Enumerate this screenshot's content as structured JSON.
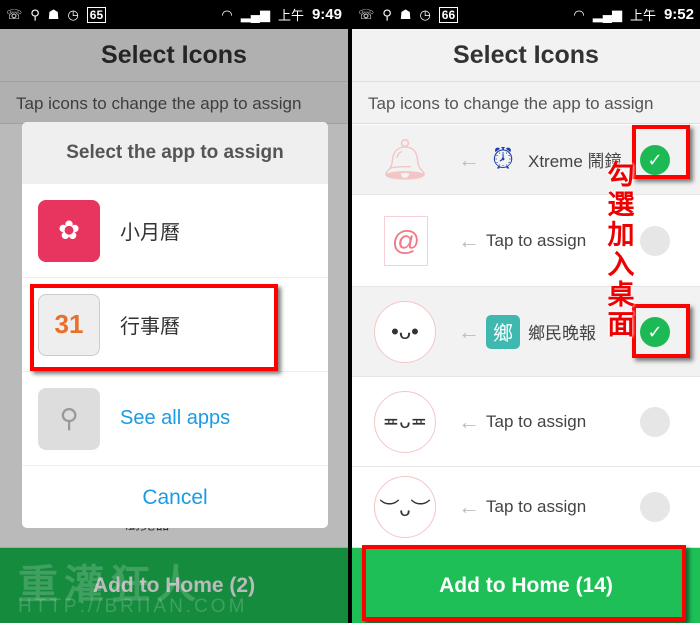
{
  "left": {
    "status": {
      "battery": "65",
      "time_prefix": "上午",
      "time": "9:49"
    },
    "header": {
      "title": "Select Icons"
    },
    "subtitle": "Tap icons to change the app to assign",
    "background_item": "瀏覽器",
    "dialog": {
      "title": "Select the app to assign",
      "items": [
        {
          "label": "小月曆",
          "icon": "pink-calendar-book-icon"
        },
        {
          "label": "行事曆",
          "icon": "calendar-31-icon",
          "icon_text": "31"
        }
      ],
      "see_all": "See all apps",
      "cancel": "Cancel"
    },
    "add_button": "Add to Home (2)",
    "watermark": "重灌狂人",
    "watermark_url": "HTTP://BRIIAN.COM"
  },
  "right": {
    "status": {
      "battery": "66",
      "time_prefix": "上午",
      "time": "9:52"
    },
    "header": {
      "title": "Select Icons"
    },
    "subtitle": "Tap icons to change the app to assign",
    "rows": [
      {
        "sticker": "bell-icon",
        "app": "Xtreme 鬧鐘...",
        "app_icon": "alarm-clock-icon",
        "checked": true
      },
      {
        "sticker": "at-sign-icon",
        "app": "Tap to assign",
        "checked": false
      },
      {
        "sticker": "bunny-icon",
        "app": "鄉民晚報",
        "app_icon": "news-icon",
        "app_icon_text": "鄉",
        "checked": true
      },
      {
        "sticker": "bunny-sweat-icon",
        "app": "Tap to assign",
        "checked": false
      },
      {
        "sticker": "bunny-smile-icon",
        "app": "Tap to assign",
        "checked": false
      }
    ],
    "annotation": "勾選加入桌面",
    "add_button": "Add to Home (14)"
  },
  "colors": {
    "accent_green": "#1dbf56",
    "check_green": "#1db954",
    "link_blue": "#1a9be6",
    "highlight_red": "#ff0000"
  }
}
